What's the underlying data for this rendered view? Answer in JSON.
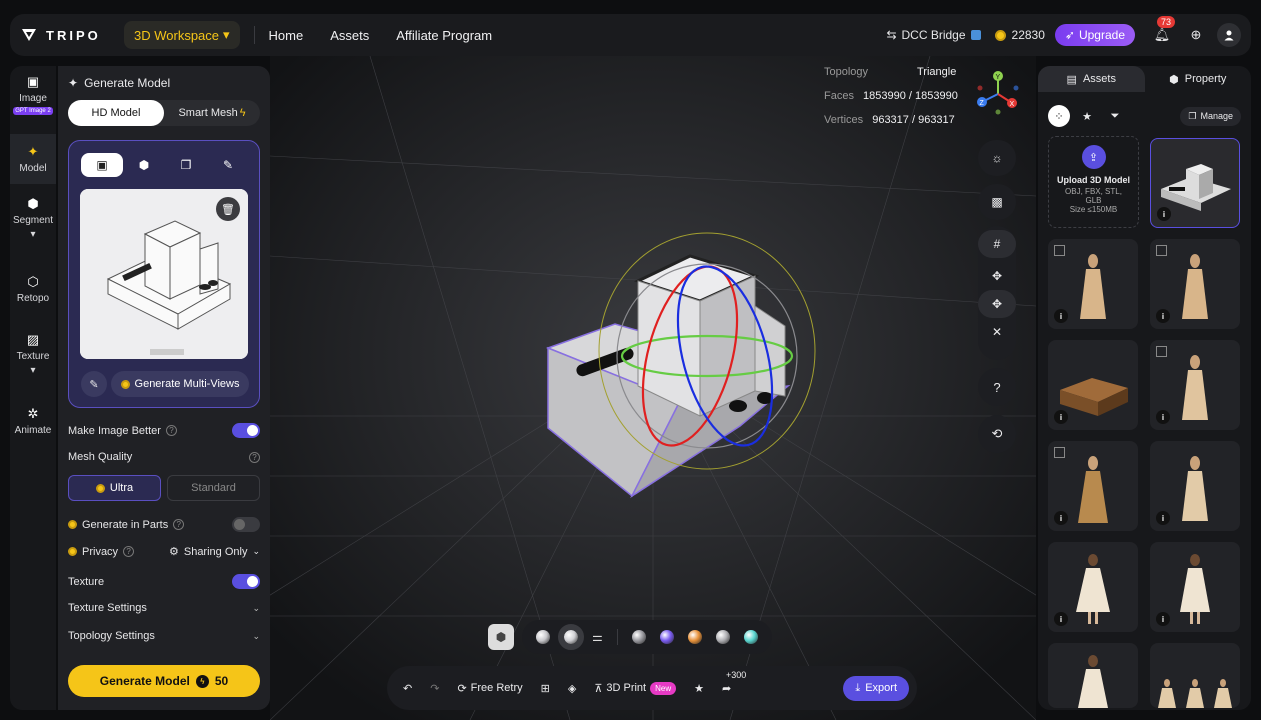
{
  "header": {
    "logo_text": "TRIPO",
    "workspace_label": "3D Workspace",
    "nav": [
      "Home",
      "Assets",
      "Affiliate Program"
    ],
    "dcc_label": "DCC Bridge",
    "credits": "22830",
    "upgrade_label": "Upgrade",
    "notification_count": "73"
  },
  "rail": {
    "items": [
      {
        "label": "Image",
        "tag": "GPT Image 2"
      },
      {
        "label": "Model"
      },
      {
        "label": "Segment"
      },
      {
        "label": "Retopo"
      },
      {
        "label": "Texture"
      },
      {
        "label": "Animate"
      }
    ]
  },
  "panel": {
    "title": "Generate Model",
    "mode_tabs": [
      "HD Model",
      "Smart Mesh"
    ],
    "multiview_label": "Generate Multi-Views",
    "make_better_label": "Make Image Better",
    "mesh_quality_label": "Mesh Quality",
    "quality_options": [
      "Ultra",
      "Standard"
    ],
    "generate_parts_label": "Generate in Parts",
    "privacy_label": "Privacy",
    "privacy_value": "Sharing Only",
    "texture_label": "Texture",
    "texture_settings_label": "Texture Settings",
    "topology_settings_label": "Topology Settings",
    "generate_button_label": "Generate Model",
    "generate_cost": "50"
  },
  "viewport": {
    "stats": [
      {
        "label": "Topology",
        "value": "Triangle"
      },
      {
        "label": "Faces",
        "value": "1853990 / 1853990"
      },
      {
        "label": "Vertices",
        "value": "963317 / 963317"
      }
    ],
    "bottom_bar": {
      "retry_label": "Free Retry",
      "print_label": "3D Print",
      "new_tag": "New",
      "share_bonus": "+300",
      "export_label": "Export"
    },
    "material_colors": [
      "#c8c8cc",
      "#d0d0d4",
      "#9a9aa0",
      "#7a5cf0",
      "#e8923a",
      "#b0b0b4",
      "#5ad6d0"
    ]
  },
  "assets_panel": {
    "tabs": [
      "Assets",
      "Property"
    ],
    "manage_label": "Manage",
    "upload_title": "Upload 3D Model",
    "upload_formats": "OBJ, FBX, STL, GLB",
    "upload_size": "Size ≤150MB",
    "info_glyph": "i"
  },
  "colors": {
    "accent_yellow": "#f5c518",
    "accent_purple": "#5a4fe0",
    "background": "#0d0e10"
  }
}
